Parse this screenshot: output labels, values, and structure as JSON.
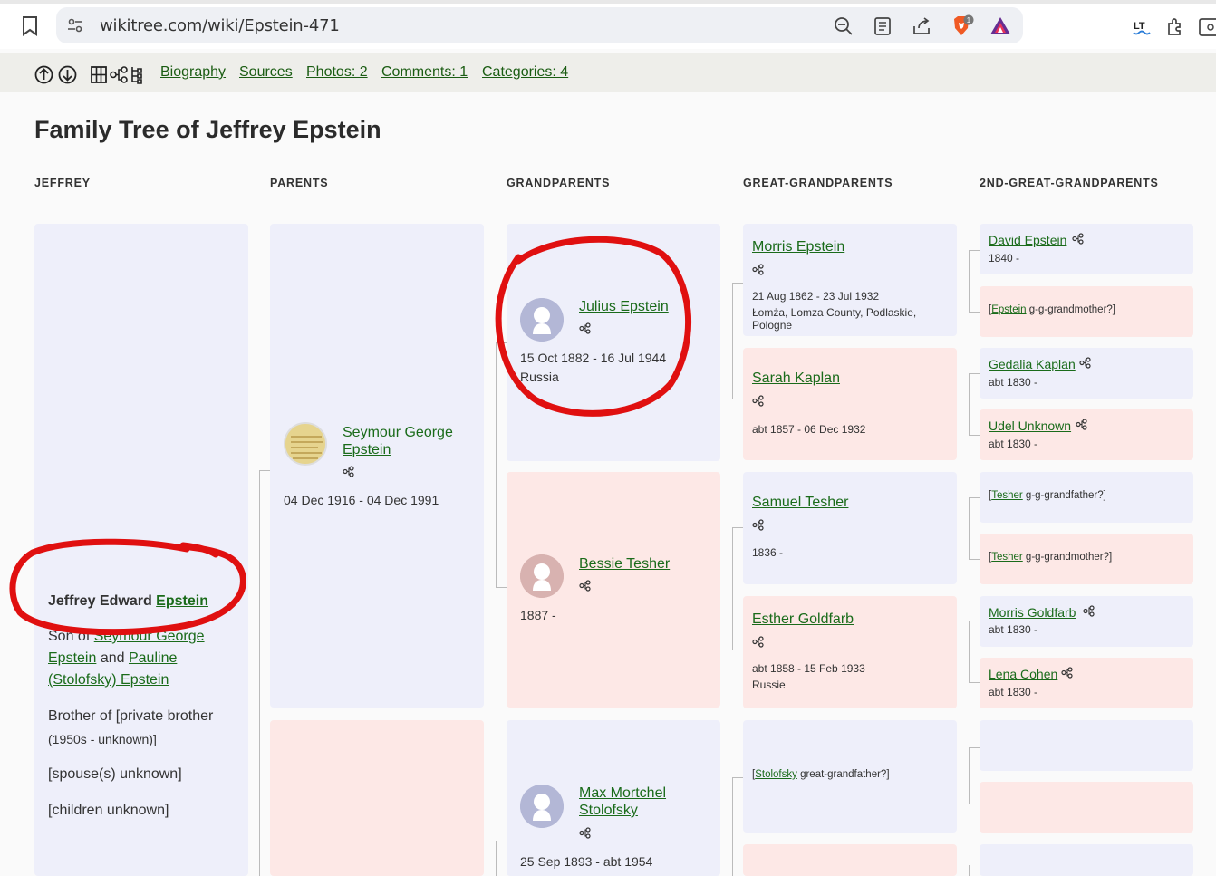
{
  "browser": {
    "url": "wikitree.com/wiki/Epstein-471",
    "brave_badge": "1"
  },
  "toolbar": {
    "links": [
      "Biography",
      "Sources",
      "Photos: 2",
      "Comments: 1",
      "Categories: 4"
    ]
  },
  "page": {
    "title": "Family Tree of Jeffrey Epstein"
  },
  "columns": [
    "JEFFREY",
    "PARENTS",
    "GRANDPARENTS",
    "GREAT-GRANDPARENTS",
    "2ND-GREAT-GRANDPARENTS"
  ],
  "main_person": {
    "first": "Jeffrey Edward",
    "last": "Epstein",
    "son_of_prefix": "Son of",
    "father_link": "Seymour George Epstein",
    "father_l1": "Seymour George",
    "father_l2": "Epstein",
    "and": "and",
    "mother_l1": "Pauline",
    "mother_l2": "(Stolofsky) Epstein",
    "brother": "Brother of [private brother",
    "brother_dates": "(1950s - unknown)]",
    "spouse": "[spouse(s) unknown]",
    "children": "[children unknown]"
  },
  "parents": {
    "father": {
      "name_l1": "Seymour George",
      "name_l2": "Epstein",
      "dates": "04 Dec 1916 - 04 Dec 1991"
    }
  },
  "grandparents": {
    "julius": {
      "name": "Julius Epstein",
      "dates": "15 Oct 1882 - 16 Jul 1944",
      "place": "Russia"
    },
    "bessie": {
      "name": "Bessie Tesher",
      "dates": "1887 -"
    },
    "max": {
      "name_l1": "Max Mortchel",
      "name_l2": "Stolofsky",
      "dates": "25 Sep 1893 - abt 1954"
    }
  },
  "great_grandparents": {
    "morris": {
      "name": "Morris Epstein",
      "dates": "21 Aug 1862 - 23 Jul 1932",
      "place": "Łomża, Lomza County, Podlaskie, Pologne"
    },
    "sarah": {
      "name": "Sarah Kaplan",
      "dates": "abt 1857 - 06 Dec 1932"
    },
    "samuel": {
      "name": "Samuel Tesher",
      "dates": "1836 -"
    },
    "esther": {
      "name": "Esther Goldfarb",
      "dates": "abt 1858 - 15 Feb 1933",
      "place": "Russie"
    },
    "stolofsky_ph": {
      "link": "Stolofsky",
      "rest": " great-grandfather?]"
    }
  },
  "gg_grandparents": {
    "david": {
      "name": "David Epstein",
      "dates": "1840 -"
    },
    "epstein_ph": {
      "link": "Epstein",
      "rest": " g-g-grandmother?]"
    },
    "gedalia": {
      "name": "Gedalia Kaplan",
      "dates": "abt 1830 -"
    },
    "udel": {
      "name": "Udel Unknown",
      "dates": "abt 1830 -"
    },
    "tesher_ph1": {
      "link": "Tesher",
      "rest": " g-g-grandfather?]"
    },
    "tesher_ph2": {
      "link": "Tesher",
      "rest": " g-g-grandmother?]"
    },
    "morris_g": {
      "name": "Morris Goldfarb",
      "dates": "abt 1830 -"
    },
    "lena": {
      "name": "Lena Cohen",
      "dates": "abt 1830 -"
    }
  },
  "colors": {
    "link": "#1a6b1a",
    "male_bg": "#eeeffa",
    "female_bg": "#fde8e6",
    "annotation": "#e01010"
  }
}
